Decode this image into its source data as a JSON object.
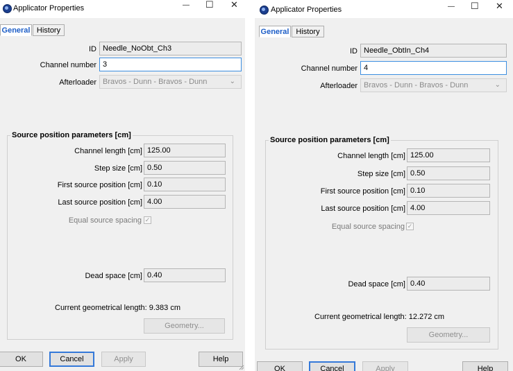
{
  "left": {
    "title": "Applicator Properties",
    "tabs": [
      {
        "label": "General"
      },
      {
        "label": "History"
      }
    ],
    "id_label": "ID",
    "id_value": "Needle_NoObt_Ch3",
    "channel_label": "Channel number",
    "channel_value": "3",
    "afterloader_label": "Afterloader",
    "afterloader_value": "Bravos - Dunn - Bravos - Dunn",
    "group_label": "Source position parameters [cm]",
    "channel_length_label": "Channel length [cm]",
    "channel_length_value": "125.00",
    "step_size_label": "Step size [cm]",
    "step_size_value": "0.50",
    "first_pos_label": "First source position [cm]",
    "first_pos_value": "0.10",
    "last_pos_label": "Last source position [cm]",
    "last_pos_value": "4.00",
    "equal_spacing_label": "Equal source spacing",
    "dead_space_label": "Dead space [cm]",
    "dead_space_value": "0.40",
    "geom_length_text": "Current geometrical length: 9.383 cm",
    "geometry_button": "Geometry...",
    "ok": "OK",
    "cancel": "Cancel",
    "apply": "Apply",
    "help": "Help"
  },
  "right": {
    "title": "Applicator Properties",
    "tabs": [
      {
        "label": "General"
      },
      {
        "label": "History"
      }
    ],
    "id_label": "ID",
    "id_value": "Needle_ObtIn_Ch4",
    "channel_label": "Channel number",
    "channel_value": "4",
    "afterloader_label": "Afterloader",
    "afterloader_value": "Bravos - Dunn - Bravos - Dunn",
    "group_label": "Source position parameters [cm]",
    "channel_length_label": "Channel length [cm]",
    "channel_length_value": "125.00",
    "step_size_label": "Step size [cm]",
    "step_size_value": "0.50",
    "first_pos_label": "First source position [cm]",
    "first_pos_value": "0.10",
    "last_pos_label": "Last source position [cm]",
    "last_pos_value": "4.00",
    "equal_spacing_label": "Equal source spacing",
    "dead_space_label": "Dead space [cm]",
    "dead_space_value": "0.40",
    "geom_length_text": "Current geometrical length: 12.272 cm",
    "geometry_button": "Geometry...",
    "ok": "OK",
    "cancel": "Cancel",
    "apply": "Apply",
    "help": "Help"
  },
  "window_controls": {
    "minimize": "—",
    "maximize": "☐",
    "close": "✕"
  },
  "icons": {
    "app": "applicator-app-icon",
    "dropdown": "chevron-down-icon",
    "check": "checkmark-icon"
  }
}
